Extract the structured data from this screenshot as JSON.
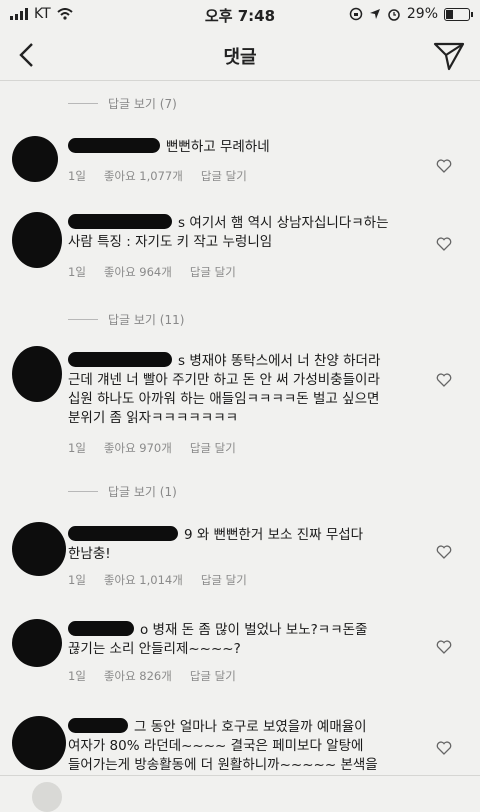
{
  "status": {
    "carrier": "KT",
    "time": "오후 7:48",
    "battery_pct": "29%",
    "battery_level": 0.29
  },
  "nav": {
    "title": "댓글",
    "back_icon": "chevron-left-icon",
    "send_icon": "paper-plane-icon"
  },
  "replies_links": [
    "답글 보기 (7)",
    "답글 보기 (11)",
    "답글 보기 (1)"
  ],
  "comments": [
    {
      "lines": [
        "뻔뻔하고 무례하네"
      ],
      "time": "1일",
      "likes": "좋아요 1,077개",
      "reply": "답글 달기"
    },
    {
      "lines": [
        "s 여기서 햄 역시 상남자십니다ㅋ하는",
        "사람 특징 : 자기도 키 작고 누렁니임"
      ],
      "time": "1일",
      "likes": "좋아요 964개",
      "reply": "답글 달기"
    },
    {
      "lines": [
        "s 병재야 똥탁스에서 너 찬양 하더라",
        "근데 걔넨 너 빨아 주기만 하고 돈 안 써 가성비충들이라",
        "십원 하나도 아까워 하는 애들임ㅋㅋㅋㅋ돈 벌고 싶으면",
        "분위기 좀 읽자ㅋㅋㅋㅋㅋㅋㅋ"
      ],
      "time": "1일",
      "likes": "좋아요 970개",
      "reply": "답글 달기"
    },
    {
      "lines": [
        "9 와 뻔뻔한거 보소 진짜 무섭다",
        "한남충!"
      ],
      "time": "1일",
      "likes": "좋아요 1,014개",
      "reply": "답글 달기"
    },
    {
      "lines": [
        "o 병재 돈 좀 많이 벌었나 보노?ㅋㅋ돈줄",
        "끊기는 소리 안들리제~~~~?"
      ],
      "time": "1일",
      "likes": "좋아요 826개",
      "reply": "답글 달기"
    },
    {
      "lines": [
        "그 동안 얼마나 호구로 보였을까 예매율이",
        "여자가 80% 라던데~~~~ 결국은 페미보다 알탕에",
        "들어가는게 방송활동에 더 원활하니까~~~~~ 본색을"
      ],
      "time": "",
      "likes": "",
      "reply": ""
    }
  ]
}
